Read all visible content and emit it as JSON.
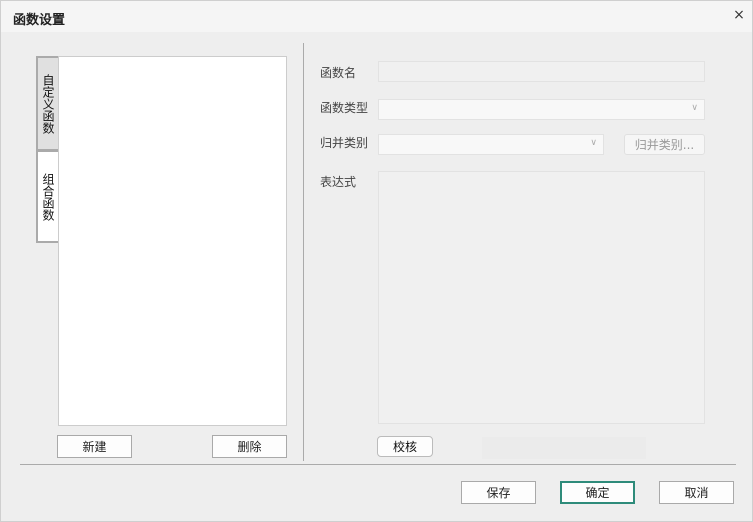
{
  "window": {
    "title": "函数设置",
    "close_icon": "×"
  },
  "tabs": [
    {
      "label": "自定义函数",
      "selected": true
    },
    {
      "label": "组合函数",
      "selected": false
    }
  ],
  "left_buttons": {
    "new": "新建",
    "delete": "删除"
  },
  "form": {
    "name_label": "函数名",
    "name_value": "",
    "type_label": "函数类型",
    "type_value": "",
    "merge_label": "归并类别",
    "merge_value": "",
    "merge_button": "归并类别...",
    "expr_label": "表达式",
    "expr_value": "",
    "check_button": "校核"
  },
  "footer": {
    "save": "保存",
    "ok": "确定",
    "cancel": "取消"
  },
  "colors": {
    "accent": "#2e8b7a"
  }
}
